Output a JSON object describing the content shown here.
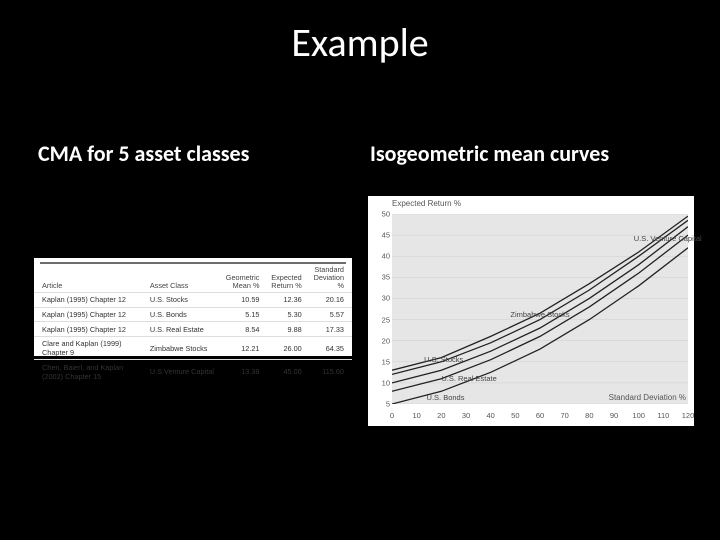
{
  "slide": {
    "title": "Example",
    "left_heading": "CMA for 5 asset classes",
    "right_heading": "Isogeometric mean curves"
  },
  "table": {
    "headers": {
      "article": "Article",
      "asset_class": "Asset Class",
      "geo_mean": "Geometric\nMean %",
      "exp_return": "Expected\nReturn %",
      "stddev": "Standard\nDeviation %"
    },
    "rows": [
      {
        "article": "Kaplan (1995) Chapter 12",
        "asset_class": "U.S. Stocks",
        "geo_mean": "10.59",
        "exp_return": "12.36",
        "stddev": "20.16"
      },
      {
        "article": "Kaplan (1995) Chapter 12",
        "asset_class": "U.S. Bonds",
        "geo_mean": "5.15",
        "exp_return": "5.30",
        "stddev": "5.57"
      },
      {
        "article": "Kaplan (1995) Chapter 12",
        "asset_class": "U.S. Real Estate",
        "geo_mean": "8.54",
        "exp_return": "9.88",
        "stddev": "17.33"
      },
      {
        "article": "Clare and Kaplan (1999) Chapter 9",
        "asset_class": "Zimbabwe Stocks",
        "geo_mean": "12.21",
        "exp_return": "26.00",
        "stddev": "64.35"
      },
      {
        "article": "Chen, Baierl, and Kaplan (2002) Chapter 15",
        "asset_class": "U.S Venture Capital",
        "geo_mean": "13.38",
        "exp_return": "45.00",
        "stddev": "115.60"
      }
    ]
  },
  "chart_data": {
    "type": "line",
    "title": "",
    "xlabel": "Standard Deviation %",
    "ylabel": "Expected Return %",
    "xlim": [
      0,
      120
    ],
    "ylim": [
      5,
      50
    ],
    "x_ticks": [
      0,
      10,
      20,
      30,
      40,
      50,
      60,
      70,
      80,
      90,
      100,
      110,
      120
    ],
    "y_ticks": [
      5,
      10,
      15,
      20,
      25,
      30,
      35,
      40,
      45,
      50
    ],
    "series": [
      {
        "name": "U.S. Bonds",
        "x": [
          0,
          20,
          40,
          60,
          80,
          100,
          120
        ],
        "y": [
          5,
          8,
          12.5,
          18,
          25,
          33,
          42
        ]
      },
      {
        "name": "U.S. Real Estate",
        "x": [
          0,
          20,
          40,
          60,
          80,
          100,
          120
        ],
        "y": [
          8,
          11,
          15.5,
          21,
          28,
          36,
          45
        ]
      },
      {
        "name": "U.S. Stocks",
        "x": [
          0,
          20,
          40,
          60,
          80,
          100,
          120
        ],
        "y": [
          10,
          13,
          17.5,
          23,
          30,
          38,
          47
        ]
      },
      {
        "name": "Zimbabwe Stocks",
        "x": [
          0,
          20,
          40,
          60,
          80,
          100,
          120
        ],
        "y": [
          12,
          15,
          19.5,
          25,
          32,
          40,
          48.5
        ]
      },
      {
        "name": "U.S. Venture Capital",
        "x": [
          0,
          20,
          40,
          60,
          80,
          100,
          120
        ],
        "y": [
          13,
          16,
          21,
          26.5,
          33.5,
          41,
          49.5
        ]
      }
    ],
    "series_label_positions": [
      {
        "name": "U.S. Bonds",
        "x": 14,
        "y": 6.5
      },
      {
        "name": "U.S. Real Estate",
        "x": 20,
        "y": 11
      },
      {
        "name": "U.S. Stocks",
        "x": 13,
        "y": 15.5
      },
      {
        "name": "Zimbabwe Stocks",
        "x": 48,
        "y": 26
      },
      {
        "name": "U.S. Venture Capital",
        "x": 98,
        "y": 44
      }
    ]
  }
}
